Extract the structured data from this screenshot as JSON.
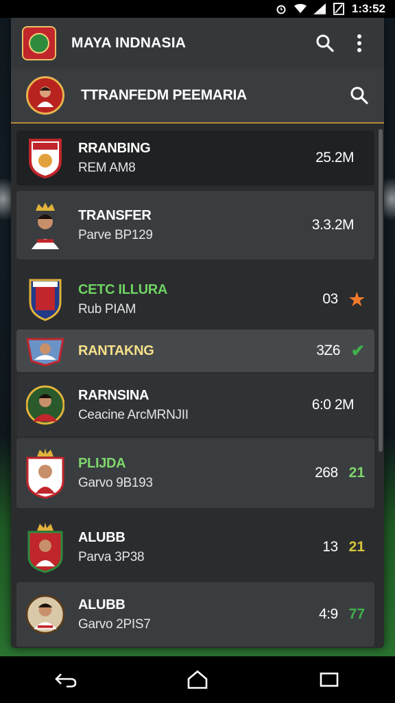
{
  "status_bar": {
    "time": "1:3:52"
  },
  "app_bar": {
    "title": "MAYA INDNASIA"
  },
  "header": {
    "title": "TTRANFEDM PEEMARIA"
  },
  "rows": [
    {
      "name": "RRANBING",
      "sub": "REM AM8",
      "value": "25.2M",
      "extra": "",
      "name_color": "#ffffff",
      "extra_color": ""
    },
    {
      "name": "TRANSFER",
      "sub": "Parve BP129",
      "value": "3.3.2M",
      "extra": "",
      "name_color": "#ffffff",
      "extra_color": ""
    },
    {
      "name": "CETC ILLURA",
      "sub": "Rub PIAM",
      "value": "03",
      "extra": "★",
      "name_color": "#6fd463",
      "extra_color": "#f07a2a"
    },
    {
      "name": "RANTAKNG",
      "sub": "",
      "value": "3Z6",
      "extra": "✔",
      "name_color": "#f5e08a",
      "extra_color": "#3fb34a"
    },
    {
      "name": "RARNSINA",
      "sub": "Ceacine ArcMRNJII",
      "value": "6:0 2M",
      "extra": "",
      "name_color": "#ffffff",
      "extra_color": ""
    },
    {
      "name": "PLIJDA",
      "sub": "Garvo 9B193",
      "value": "268",
      "extra": "21",
      "name_color": "#7fd66b",
      "extra_color": "#7fd66b"
    },
    {
      "name": "ALUBB",
      "sub": "Parva 3P38",
      "value": "13",
      "extra": "21",
      "name_color": "#ffffff",
      "extra_color": "#d6c53a"
    },
    {
      "name": "ALUBB",
      "sub": "Garvo 2PIS7",
      "value": "4:9",
      "extra": "77",
      "name_color": "#ffffff",
      "extra_color": "#3fb34a"
    }
  ],
  "icons": {
    "status": [
      "alarm-icon",
      "wifi-icon",
      "signal-icon",
      "battery-icon"
    ],
    "app_bar": [
      "app-logo",
      "search-icon",
      "more-vert-icon"
    ],
    "nav": [
      "back-icon",
      "home-icon",
      "recents-icon"
    ]
  }
}
